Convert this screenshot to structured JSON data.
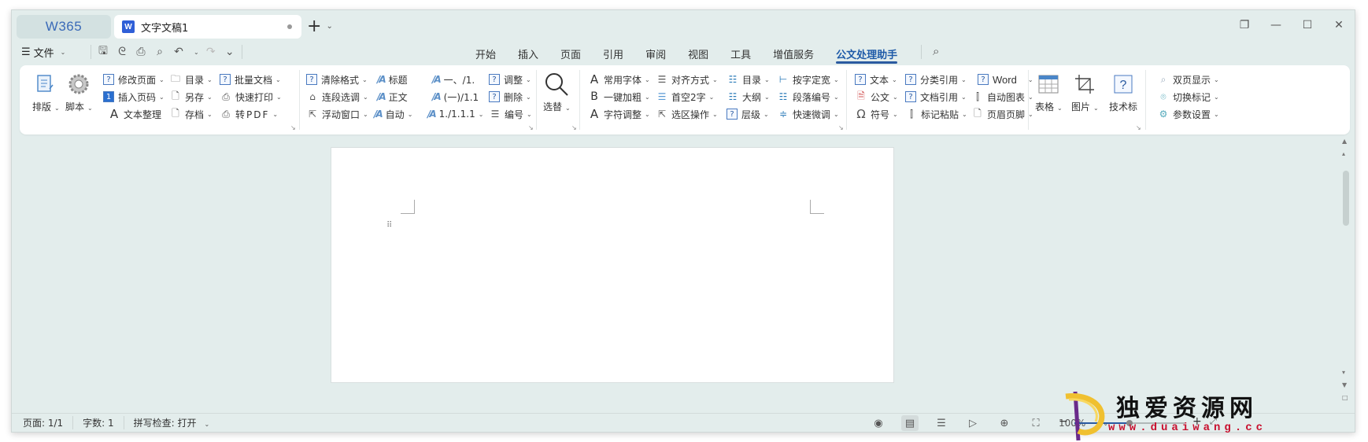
{
  "app": {
    "logo": "W365"
  },
  "tab": {
    "title": "文字文稿1",
    "icon_letter": "W"
  },
  "window_controls": [
    "restore-layout",
    "minimize",
    "maximize",
    "close"
  ],
  "menubar": {
    "file_label": "文件",
    "tabs": [
      {
        "label": "开始",
        "active": false
      },
      {
        "label": "插入",
        "active": false
      },
      {
        "label": "页面",
        "active": false
      },
      {
        "label": "引用",
        "active": false
      },
      {
        "label": "审阅",
        "active": false
      },
      {
        "label": "视图",
        "active": false
      },
      {
        "label": "工具",
        "active": false
      },
      {
        "label": "增值服务",
        "active": false
      },
      {
        "label": "公文处理助手",
        "active": true
      }
    ]
  },
  "ribbon": {
    "g1": {
      "paiban": "排版",
      "jiaoben": "脚本",
      "items": [
        "修改页面",
        "插入页码",
        "文本整理",
        "目录",
        "另存",
        "存档",
        "批量文档",
        "快速打印",
        "转PDF"
      ]
    },
    "g2": {
      "items": [
        "清除格式",
        "连段选调",
        "浮动窗口",
        "标题",
        "正文",
        "自动",
        "一、/1.",
        "(一)/1.1",
        "1./1.1.1",
        "调整",
        "删除",
        "编号"
      ]
    },
    "g3": {
      "label": "选替"
    },
    "g4": {
      "items": [
        "常用字体",
        "一键加粗",
        "字符调整",
        "对齐方式",
        "首空2字",
        "选区操作",
        "目录",
        "大纲",
        "层级",
        "按字定宽",
        "段落编号",
        "快速微调"
      ]
    },
    "g5": {
      "items": [
        "文本",
        "公文",
        "符号",
        "分类引用",
        "文档引用",
        "标记粘贴",
        "Word",
        "自动图表",
        "页眉页脚"
      ]
    },
    "g6": {
      "items": [
        "表格",
        "图片",
        "技术标"
      ]
    },
    "g7": {
      "items": [
        "双页显示",
        "切换标记",
        "参数设置"
      ]
    }
  },
  "statusbar": {
    "page": "页面: 1/1",
    "wordcount": "字数: 1",
    "spellcheck": "拼写检查: 打开",
    "zoom": "100%",
    "zoom_level_percent": 100
  },
  "watermark": {
    "text": "独爱资源网",
    "url": "www.duaiwang.cc"
  }
}
